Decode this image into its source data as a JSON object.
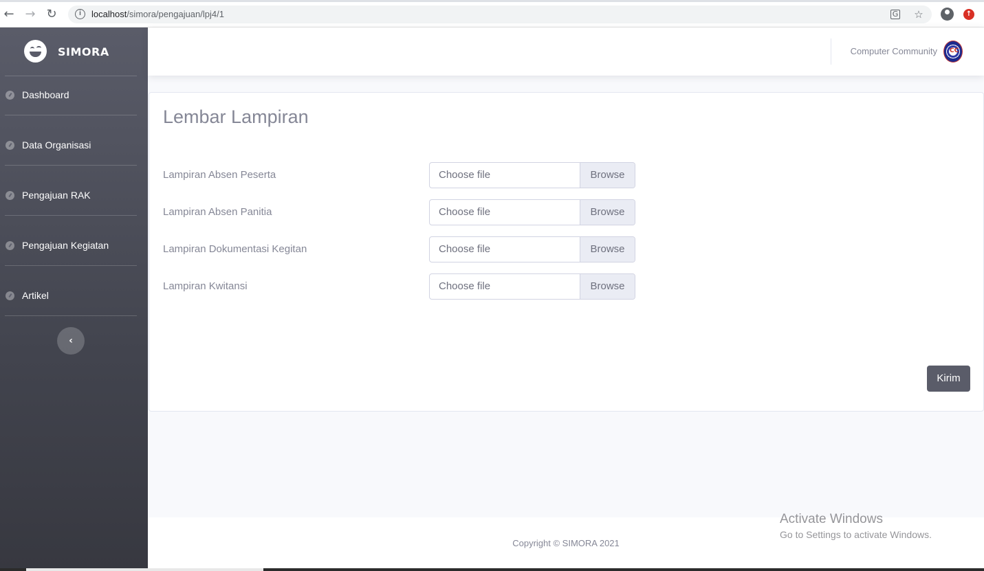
{
  "browser": {
    "url_host": "localhost",
    "url_path": "/simora/pengajuan/lpj4/1"
  },
  "sidebar": {
    "brand": "SIMORA",
    "items": [
      {
        "label": "Dashboard",
        "icon": "tachometer-icon"
      },
      {
        "label": "Data Organisasi",
        "icon": "tachometer-icon"
      },
      {
        "label": "Pengajuan RAK",
        "icon": "tachometer-icon"
      },
      {
        "label": "Pengajuan Kegiatan",
        "icon": "tachometer-icon"
      },
      {
        "label": "Artikel",
        "icon": "tachometer-icon"
      }
    ],
    "toggle_icon": "‹"
  },
  "topbar": {
    "user_name": "Computer Community"
  },
  "form": {
    "title": "Lembar Lampiran",
    "fields": [
      {
        "label": "Lampiran Absen Peserta",
        "placeholder": "Choose file",
        "browse": "Browse"
      },
      {
        "label": "Lampiran Absen Panitia",
        "placeholder": "Choose file",
        "browse": "Browse"
      },
      {
        "label": "Lampiran Dokumentasi Kegitan",
        "placeholder": "Choose file",
        "browse": "Browse"
      },
      {
        "label": "Lampiran Kwitansi",
        "placeholder": "Choose file",
        "browse": "Browse"
      }
    ],
    "submit_label": "Kirim"
  },
  "footer": {
    "copyright": "Copyright © SIMORA 2021"
  },
  "watermark": {
    "line1": "Activate Windows",
    "line2": "Go to Settings to activate Windows."
  },
  "colors": {
    "sidebar": "#5a5c69",
    "accent": "#5a5c69",
    "page_bg": "#f8f9fc"
  }
}
